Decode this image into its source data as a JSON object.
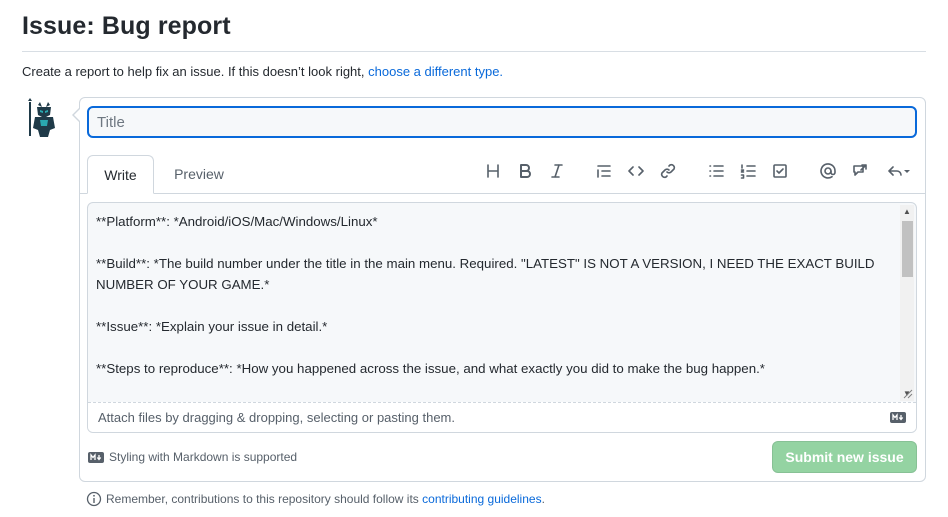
{
  "header": {
    "title": "Issue: Bug report",
    "subtitle_text": "Create a report to help fix an issue. If this doesn’t look right, ",
    "subtitle_link": "choose a different type."
  },
  "form": {
    "title_placeholder": "Title",
    "tabs": [
      {
        "label": "Write",
        "selected": true
      },
      {
        "label": "Preview",
        "selected": false
      }
    ],
    "toolbar": [
      {
        "name": "heading-icon"
      },
      {
        "name": "bold-icon"
      },
      {
        "name": "italic-icon"
      },
      {
        "name": "quote-icon"
      },
      {
        "name": "code-icon"
      },
      {
        "name": "link-icon"
      },
      {
        "name": "bulleted-list-icon"
      },
      {
        "name": "numbered-list-icon"
      },
      {
        "name": "task-list-icon"
      },
      {
        "name": "mention-icon"
      },
      {
        "name": "reference-icon"
      },
      {
        "name": "saved-replies-icon"
      }
    ],
    "body_lines": [
      "**Platform**: *Android/iOS/Mac/Windows/Linux*",
      "",
      "**Build**: *The build number under the title in the main menu. Required. \"LATEST\" IS NOT A VERSION, I NEED THE EXACT BUILD NUMBER OF YOUR GAME.*",
      "",
      "**Issue**: *Explain your issue in detail.*",
      "",
      "**Steps to reproduce**: *How you happened across the issue, and what exactly you did to make the bug happen.*"
    ],
    "attach_text": "Attach files by dragging & dropping, selecting or pasting them.",
    "markdown_note": "Styling with Markdown is supported",
    "submit_label": "Submit new issue"
  },
  "footer": {
    "text": "Remember, contributions to this repository should follow its ",
    "link": "contributing guidelines",
    "suffix": "."
  },
  "colors": {
    "accent": "#0969da",
    "submit_disabled": "#94d3a2",
    "border": "#d0d7de"
  }
}
